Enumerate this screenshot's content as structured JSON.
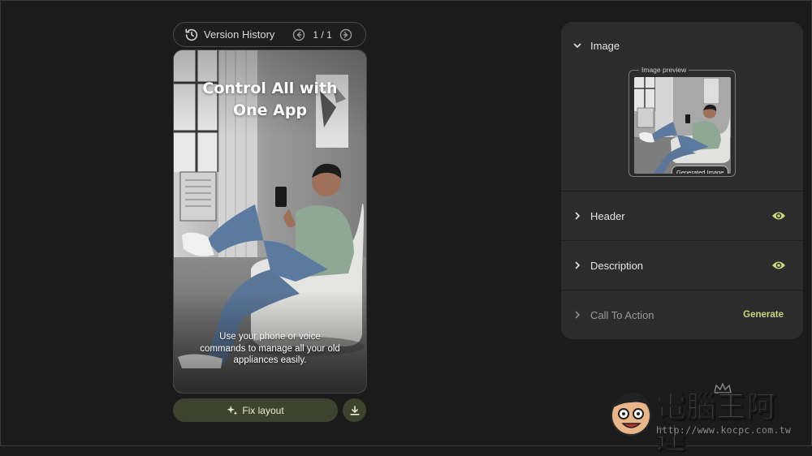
{
  "version_history": {
    "label": "Version History",
    "pager": "1 / 1"
  },
  "preview": {
    "title": "Control All with One App",
    "description": "Use your phone or voice commands to manage all your old appliances easily."
  },
  "actions": {
    "fix_layout_label": "Fix layout"
  },
  "panel": {
    "image": {
      "title": "Image",
      "preview_legend": "Image preview",
      "badge": "Generated Image"
    },
    "header": {
      "title": "Header"
    },
    "description": {
      "title": "Description"
    },
    "cta": {
      "title": "Call To Action",
      "action": "Generate"
    }
  },
  "watermark": {
    "text": "電腦王阿達",
    "url": "http://www.kocpc.com.tw"
  },
  "colors": {
    "background": "#1b1b1b",
    "panel": "#2c2c2c",
    "accent": "#c9d77e",
    "button": "#3e4330"
  },
  "icons": {
    "history": "history-icon",
    "prev": "arrow-left-circle-icon",
    "next": "arrow-right-circle-icon",
    "sparkle": "sparkle-icon",
    "download": "download-icon",
    "chevron_down": "chevron-down-icon",
    "chevron_right": "chevron-right-icon",
    "eye": "eye-icon"
  }
}
